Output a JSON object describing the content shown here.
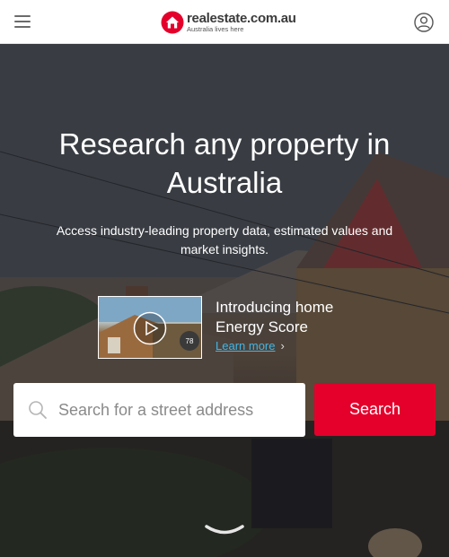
{
  "header": {
    "logo_name": "realestate.com.au",
    "logo_tagline": "Australia lives here",
    "menu_icon": "hamburger-icon",
    "account_icon": "user-icon"
  },
  "hero": {
    "headline": "Research any property in Australia",
    "subheading": "Access industry-leading property data, estimated values and market insights.",
    "promo": {
      "title": "Introducing home Energy Score",
      "link_label": "Learn more",
      "thumbnail_badge": "78"
    }
  },
  "search": {
    "placeholder": "Search for a street address",
    "button_label": "Search"
  },
  "colors": {
    "brand_red": "#e4002b",
    "link_blue": "#41b6e6"
  }
}
